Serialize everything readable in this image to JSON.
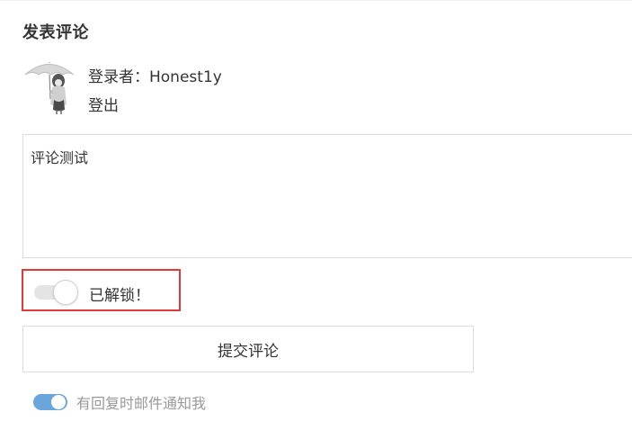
{
  "comment_section": {
    "title": "发表评论",
    "login_text": "登录者：Honest1y",
    "logout_label": "登出",
    "comment_value": "评论测试",
    "unlock_label": "已解锁！",
    "submit_label": "提交评论",
    "notify_label": "有回复时邮件通知我"
  },
  "states": {
    "unlock_toggle_on": false,
    "notify_toggle_on": true
  },
  "colors": {
    "highlight_border": "#e03a3a",
    "toggle_on": "#6aa6dc",
    "toggle_off": "#e4e4e4"
  }
}
